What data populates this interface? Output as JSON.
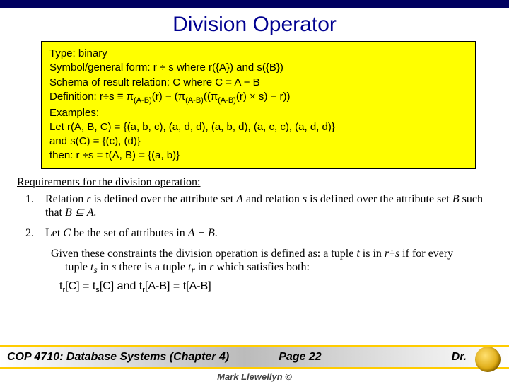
{
  "title": "Division Operator",
  "defbox": {
    "l1": "Type: binary",
    "l2": "Symbol/general form:  r ÷ s where r({A}) and s({B})",
    "l3": "Schema of result relation: C where C = A − B",
    "l4a": "Definition: r÷s ≡ π",
    "l4_sub1": "(A-B)",
    "l4b": "(r) − (π",
    "l4_sub2": "(A-B)",
    "l4c": "((π",
    "l4_sub3": "(A-B)",
    "l4d": "(r) × s) − r))",
    "l5": " Examples:",
    "l6": "Let r(A, B, C) = {(a, b, c), (a, d, d), (a, b, d), (a, c, c), (a, d, d)}",
    "l7": "and s(C) = {(c), (d)}",
    "l8": "then: r ÷s = t(A, B) = {(a, b)}"
  },
  "reqs_heading": "Requirements for the division operation:",
  "req1_a": "Relation ",
  "req1_r": "r",
  "req1_b": " is defined over the attribute set ",
  "req1_A": "A",
  "req1_c": " and relation ",
  "req1_s": "s",
  "req1_d": " is defined over the attribute set ",
  "req1_B": "B",
  "req1_e": " such that ",
  "req1_BinA": "B ⊆ A.",
  "req2_a": "Let ",
  "req2_C": "C",
  "req2_b": " be the set of attributes in ",
  "req2_AminusB": "A − B",
  "req2_c": ".",
  "given_a": "Given these constraints the division operation is defined as: a tuple ",
  "given_t": "t",
  "given_b": " is in ",
  "given_r": "r",
  "given_c": "÷",
  "given_s": "s",
  "given_d": " if for every tuple ",
  "given_ts": "t",
  "given_s_sub": "s",
  "given_e": " in ",
  "given_s2": "s",
  "given_f": " there is a tuple ",
  "given_tr": "t",
  "given_r_sub": "r",
  "given_g": " in ",
  "given_r2": "r",
  "given_h": " which satisfies both:",
  "eq": {
    "t": "t",
    "r": "r",
    "s": "s",
    "C": "[C] = ",
    "C2": "[C]  and  ",
    "AB": "[A-B] = t[A-B]"
  },
  "footer": {
    "course": "COP 4710: Database Systems  (Chapter 4)",
    "page": "Page 22",
    "author": "Dr.",
    "copyright": "Mark Llewellyn ©"
  }
}
